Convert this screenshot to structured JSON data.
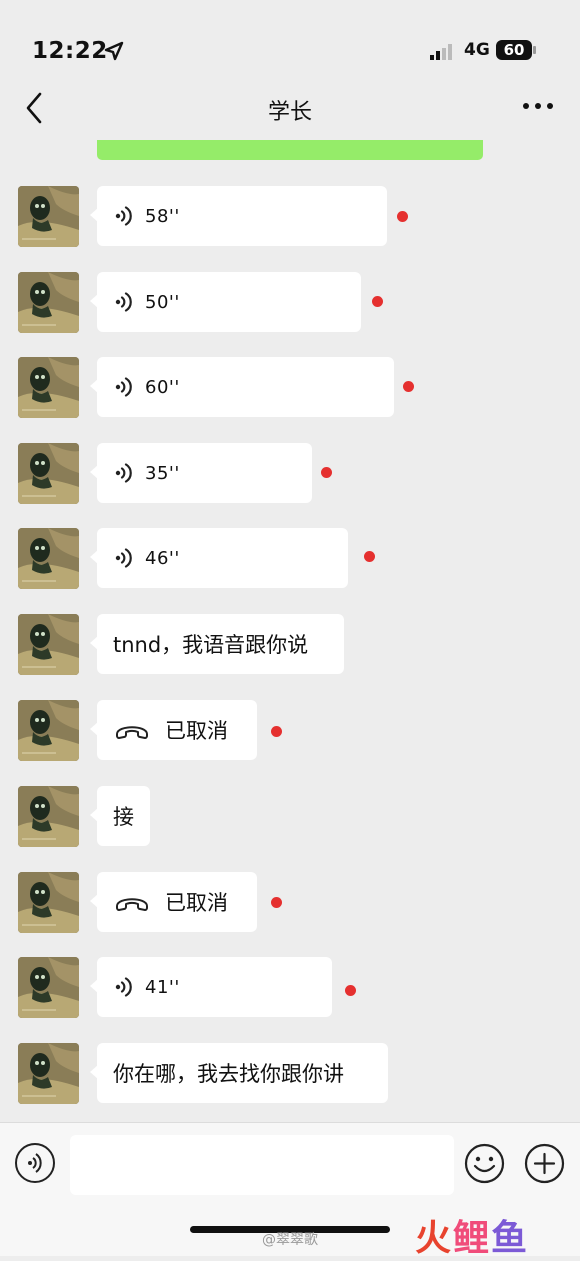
{
  "status_bar": {
    "time": "12:22",
    "network": "4G",
    "battery": "60"
  },
  "header": {
    "title": "学长"
  },
  "messages": [
    {
      "type": "voice",
      "duration": "58''",
      "unread": true
    },
    {
      "type": "voice",
      "duration": "50''",
      "unread": true
    },
    {
      "type": "voice",
      "duration": "60''",
      "unread": true
    },
    {
      "type": "voice",
      "duration": "35''",
      "unread": true
    },
    {
      "type": "voice",
      "duration": "46''",
      "unread": true
    },
    {
      "type": "text",
      "text": "tnnd，我语音跟你说",
      "unread": false
    },
    {
      "type": "call",
      "text": "已取消",
      "unread": true
    },
    {
      "type": "text",
      "text": "接",
      "unread": false
    },
    {
      "type": "call",
      "text": "已取消",
      "unread": true
    },
    {
      "type": "voice",
      "duration": "41''",
      "unread": true
    },
    {
      "type": "text",
      "text": "你在哪，我去找你跟你讲",
      "unread": false
    }
  ],
  "input_bar": {
    "message_value": "",
    "icons": [
      "voice-icon",
      "emoji-icon",
      "plus-icon"
    ]
  },
  "watermark": "@翠翠歌",
  "logo": {
    "c1": "火",
    "c2": "鲤",
    "c3": "鱼"
  },
  "colors": {
    "background": "#ededed",
    "unread_dot": "#e5302f",
    "sent_bubble": "#95ec69"
  }
}
